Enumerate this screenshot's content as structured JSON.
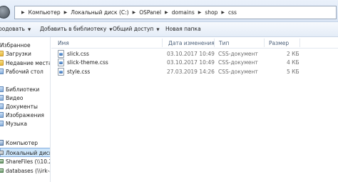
{
  "address_bar": {
    "breadcrumbs": [
      "Компьютер",
      "Локальный диск (C:)",
      "OSPanel",
      "domains",
      "shop",
      "css"
    ]
  },
  "toolbar": {
    "organize_label": "родовать",
    "add_library_label": "Добавить в библиотеку",
    "share_label": "Общий доступ",
    "new_folder_label": "Новая папка"
  },
  "navigation": {
    "favorites_header": "Избранное",
    "favorites": [
      "Загрузки",
      "Недавние места",
      "Рабочий стол"
    ],
    "libraries_header": "Библиотеки",
    "libraries": [
      "Видео",
      "Документы",
      "Изображения",
      "Музыка"
    ],
    "computer_header": "Компьютер",
    "drives": [
      "Локальный диск (C",
      "ShareFiles (\\\\10.209.",
      "databases (\\\\irk-app"
    ]
  },
  "columns": {
    "name": "Имя",
    "date": "Дата изменения",
    "type": "Тип",
    "size": "Размер"
  },
  "files": [
    {
      "name": "slick.css",
      "date": "03.10.2017 10:49",
      "type": "CSS-документ",
      "size": "2 КБ"
    },
    {
      "name": "slick-theme.css",
      "date": "03.10.2017 10:49",
      "type": "CSS-документ",
      "size": "4 КБ"
    },
    {
      "name": "style.css",
      "date": "27.03.2019 14:26",
      "type": "CSS-документ",
      "size": "5 КБ"
    }
  ]
}
